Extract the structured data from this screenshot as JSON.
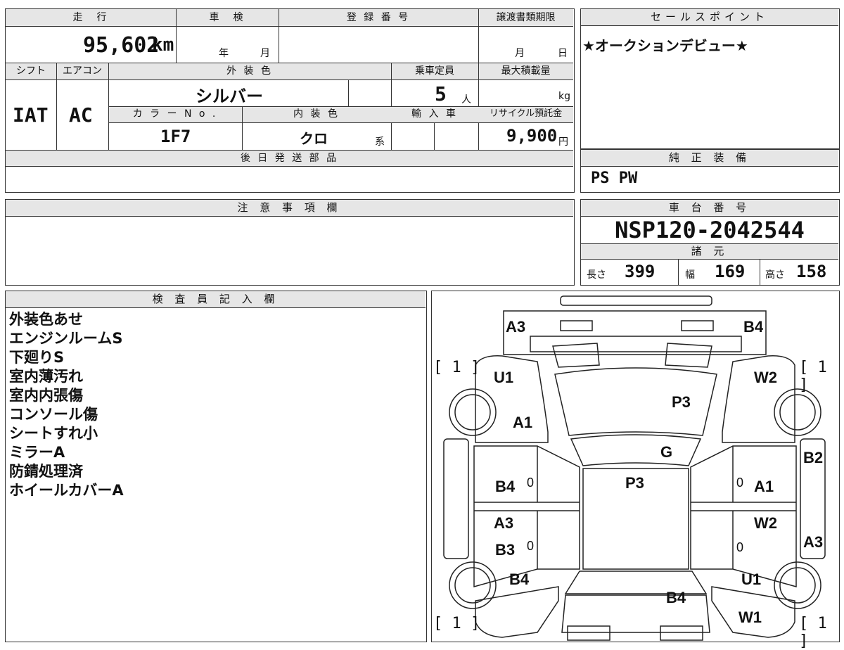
{
  "vehicle": {
    "mileage_label": "走　行",
    "mileage": "95,602",
    "mileage_unit": "km",
    "inspection_label": "車　検",
    "inspection_year_unit": "年",
    "inspection_month_unit": "月",
    "registration_label": "登 録 番 号",
    "transfer_deadline_label": "譲渡書類期限",
    "transfer_month_unit": "月",
    "transfer_day_unit": "日",
    "shift_label": "シフト",
    "shift": "IAT",
    "ac_label": "エアコン",
    "ac": "AC",
    "exterior_color_label": "外 装 色",
    "exterior_color": "シルバー",
    "capacity_label": "乗車定員",
    "capacity": "5",
    "capacity_unit": "人",
    "max_load_label": "最大積載量",
    "max_load_unit": "kg",
    "color_no_label": "カ ラ ー N o .",
    "color_no": "1F7",
    "interior_color_label": "内 装 色",
    "interior_color": "クロ",
    "interior_color_suffix": "系",
    "import_label": "輸 入 車",
    "recycle_label": "リサイクル預託金",
    "recycle_fee": "9,900",
    "recycle_unit": "円"
  },
  "sales_point": {
    "label": "セールスポイント",
    "text": "★オークションデビュー★"
  },
  "later_parts": {
    "label": "後 日 発 送 部 品"
  },
  "oem_equipment": {
    "label": "純 正 装 備",
    "text": "PS PW"
  },
  "caution": {
    "label": "注 意 事 項 欄"
  },
  "chassis": {
    "label": "車 台 番 号",
    "number": "NSP120-2042544"
  },
  "specs": {
    "label": "諸 元",
    "length_label": "長さ",
    "length": "399",
    "width_label": "幅",
    "width": "169",
    "height_label": "高さ",
    "height": "158"
  },
  "inspector": {
    "label": "検 査 員 記 入 欄",
    "notes": [
      "外装色あせ",
      "エンジンルームS",
      "下廻りS",
      "室内薄汚れ",
      "室内内張傷",
      "コンソール傷",
      "シートすれ小",
      "ミラーA",
      "防錆処理済",
      "ホイールカバーA"
    ]
  },
  "diagram": {
    "codes": {
      "a3_top": "A3",
      "b4_top": "B4",
      "u1_left": "U1",
      "w2_right": "W2",
      "a1_left": "A1",
      "p3_hood": "P3",
      "g_glass": "G",
      "b2_right": "B2",
      "b4_left_door": "B4",
      "zero_1": "0",
      "p3_roof": "P3",
      "zero_2": "0",
      "a1_right_door": "A1",
      "a3_left_door": "A3",
      "w2_right_door": "W2",
      "b3_left": "B3",
      "zero_3": "0",
      "zero_4": "0",
      "a3_right": "A3",
      "b4_left_rear": "B4",
      "u1_right_rear": "U1",
      "b4_rear": "B4",
      "w1_rear": "W1"
    },
    "brackets": [
      "[ 1 ]",
      "[ 1 ]",
      "[ 1 ]",
      "[ 1 ]"
    ]
  }
}
